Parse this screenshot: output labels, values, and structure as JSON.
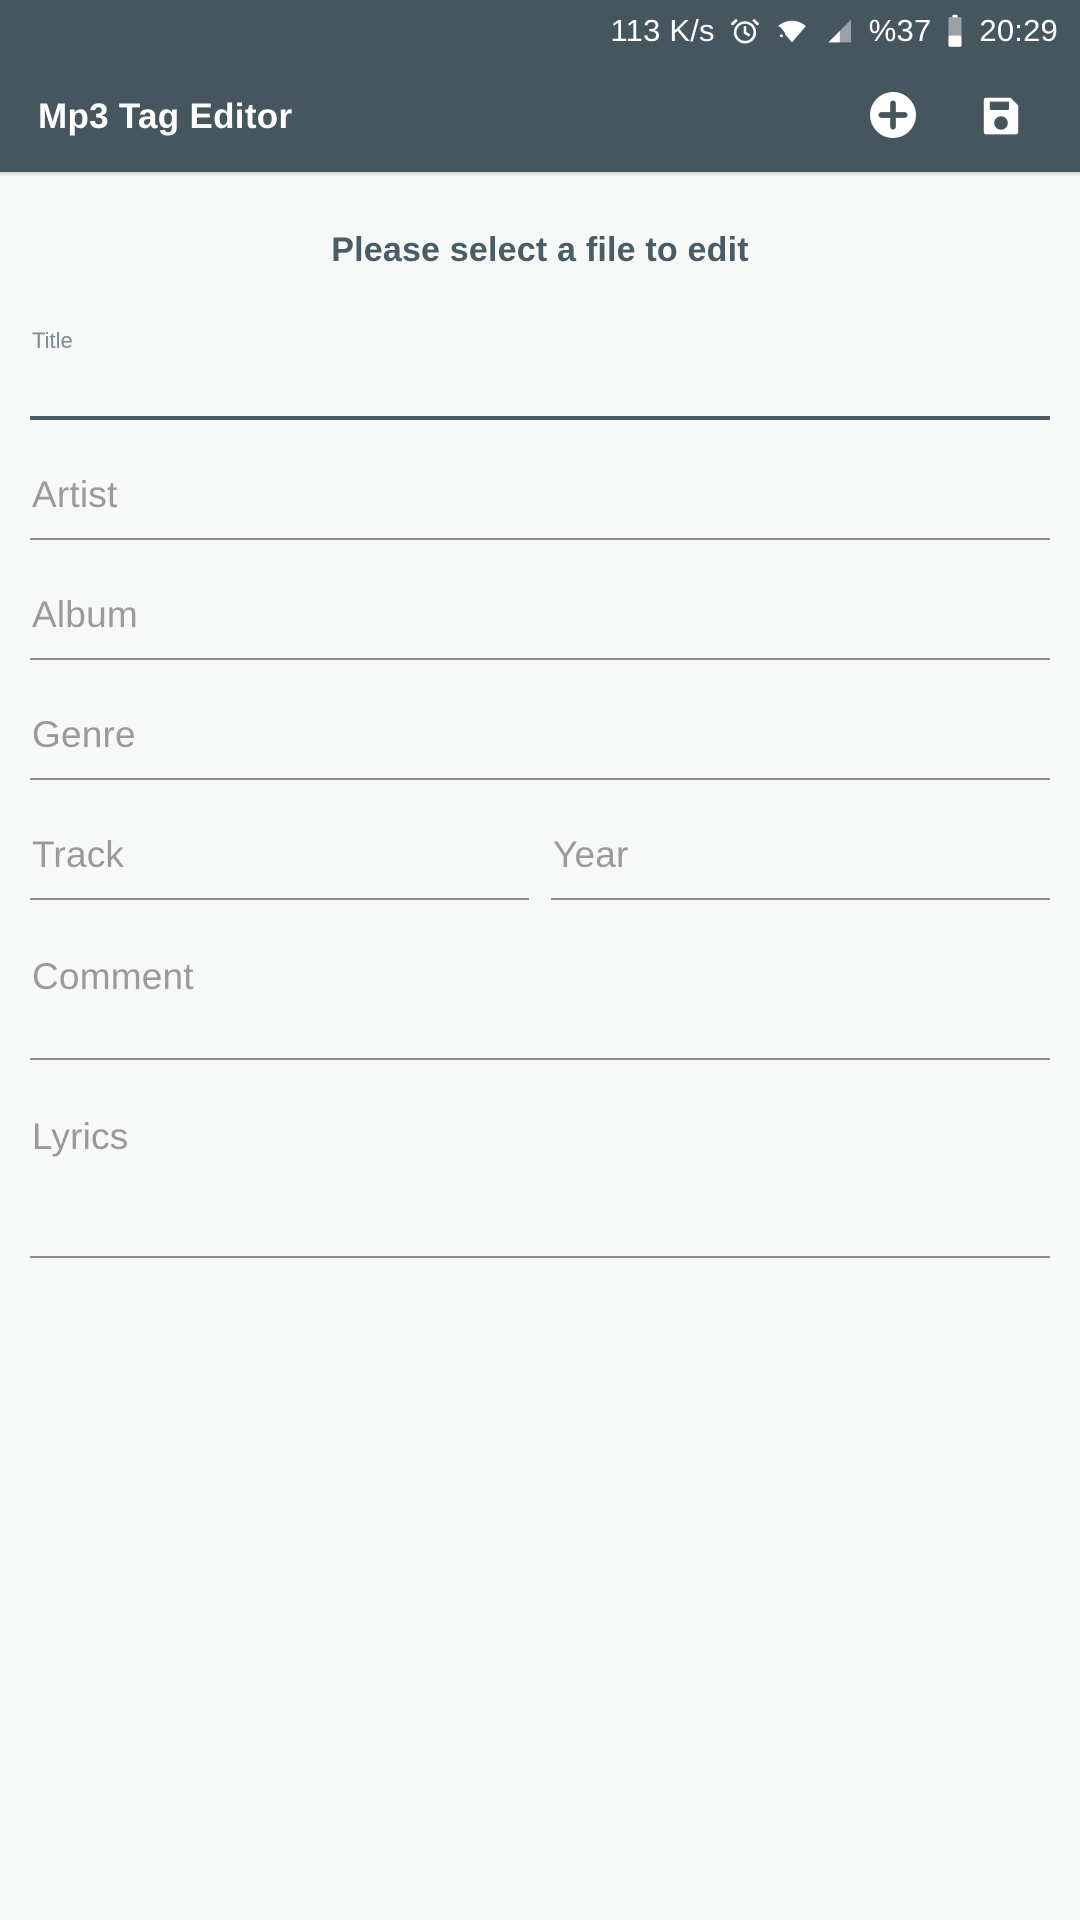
{
  "status_bar": {
    "network_speed": "113 K/s",
    "battery_percent": "%37",
    "clock": "20:29",
    "icons": [
      "alarm-icon",
      "wifi-icon",
      "signal-icon",
      "battery-icon"
    ]
  },
  "toolbar": {
    "title": "Mp3 Tag Editor",
    "add_label": "add-icon",
    "save_label": "save-icon",
    "background_color": "#46565f",
    "title_color": "#ffffff"
  },
  "main": {
    "heading": "Please select a file to edit",
    "heading_color": "#4a5c66",
    "background_color": "#f7f8f8",
    "fields": [
      {
        "name": "title",
        "label": "Title",
        "value": "",
        "placeholder": "Title",
        "focused": true,
        "type": "single"
      },
      {
        "name": "artist",
        "label": "Artist",
        "value": "",
        "placeholder": "Artist",
        "focused": false,
        "type": "single"
      },
      {
        "name": "album",
        "label": "Album",
        "value": "",
        "placeholder": "Album",
        "focused": false,
        "type": "single"
      },
      {
        "name": "genre",
        "label": "Genre",
        "value": "",
        "placeholder": "Genre",
        "focused": false,
        "type": "single"
      },
      {
        "name": "track",
        "label": "Track",
        "value": "",
        "placeholder": "Track",
        "focused": false,
        "type": "half"
      },
      {
        "name": "year",
        "label": "Year",
        "value": "",
        "placeholder": "Year",
        "focused": false,
        "type": "half"
      },
      {
        "name": "comment",
        "label": "Comment",
        "value": "",
        "placeholder": "Comment",
        "focused": false,
        "type": "multi"
      },
      {
        "name": "lyrics",
        "label": "Lyrics",
        "value": "",
        "placeholder": "Lyrics",
        "focused": false,
        "type": "multi"
      }
    ]
  },
  "colors": {
    "accent": "#46565f",
    "underline_inactive": "#8d8d8d",
    "underline_active": "#4a5c66",
    "placeholder": "#9a9a9a"
  }
}
